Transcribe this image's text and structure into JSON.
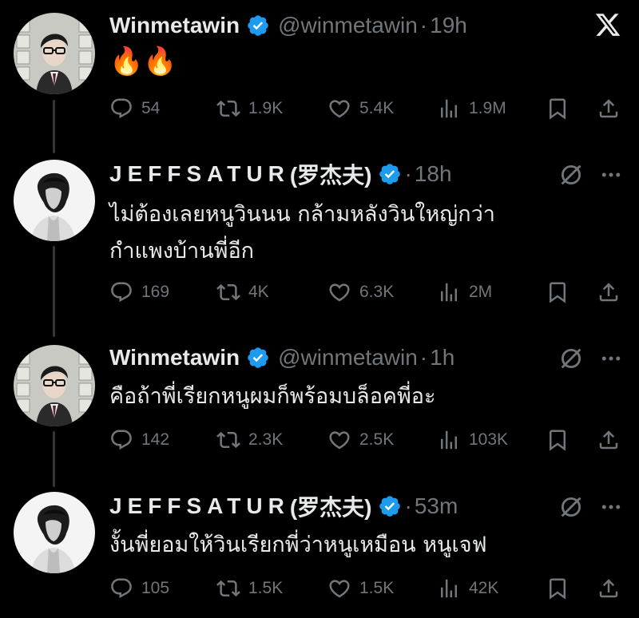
{
  "app": {
    "logo_icon": "x-logo-icon"
  },
  "colors": {
    "background": "#000000",
    "text": "#e7e9ea",
    "muted": "#71767b",
    "verified": "#1d9bf0",
    "thread_line": "#333639"
  },
  "tweets": [
    {
      "name": "Winmetawin",
      "handle": "@winmetawin",
      "dot": "·",
      "time": "19h",
      "text": "🔥🔥",
      "replies": "54",
      "reposts": "1.9K",
      "likes": "5.4K",
      "views": "1.9M"
    },
    {
      "name": "JEFFSATUR",
      "name_suffix": " (罗杰夫)",
      "dot": "·",
      "time": "18h",
      "text": "ไม่ต้องเลยหนูวินนน กล้ามหลังวินใหญ่กว่า\nกำแพงบ้านพี่อีก",
      "replies": "169",
      "reposts": "4K",
      "likes": "6.3K",
      "views": "2M"
    },
    {
      "name": "Winmetawin",
      "handle": "@winmetawin",
      "dot": "·",
      "time": "1h",
      "text": "คือถ้าพี่เรียกหนูผมก็พร้อมบล็อคพี่อะ",
      "replies": "142",
      "reposts": "2.3K",
      "likes": "2.5K",
      "views": "103K"
    },
    {
      "name": "JEFFSATUR",
      "name_suffix": " (罗杰夫)",
      "dot": "·",
      "time": "53m",
      "text": "งั้นพี่ยอมให้วินเรียกพี่ว่าหนูเหมือน หนูเจฟ",
      "replies": "105",
      "reposts": "1.5K",
      "likes": "1.5K",
      "views": "42K"
    }
  ]
}
